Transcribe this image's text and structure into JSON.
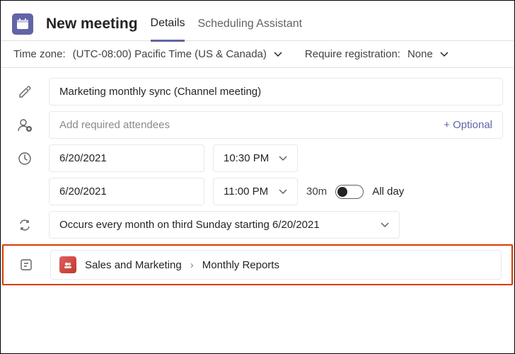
{
  "header": {
    "title": "New meeting",
    "tabs": {
      "details": "Details",
      "scheduling": "Scheduling Assistant"
    }
  },
  "subbar": {
    "timezone_label": "Time zone:",
    "timezone_value": "(UTC-08:00) Pacific Time (US & Canada)",
    "require_registration_label": "Require registration:",
    "require_registration_value": "None"
  },
  "form": {
    "title_value": "Marketing monthly sync (Channel meeting)",
    "attendees_placeholder": "Add required attendees",
    "optional_link": "+ Optional",
    "start_date": "6/20/2021",
    "start_time": "10:30 PM",
    "end_date": "6/20/2021",
    "end_time": "11:00 PM",
    "duration": "30m",
    "allday_label": "All day",
    "recurrence": "Occurs every month on third Sunday starting 6/20/2021"
  },
  "channel": {
    "team_name": "Sales and Marketing",
    "channel_name": "Monthly Reports"
  }
}
